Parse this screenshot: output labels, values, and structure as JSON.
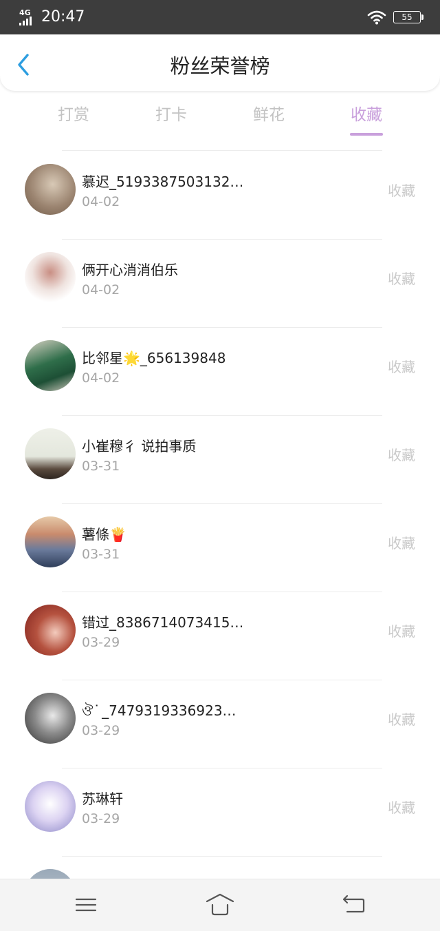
{
  "status_bar": {
    "network": "4G",
    "time": "20:47",
    "battery": "55"
  },
  "header": {
    "title": "粉丝荣誉榜"
  },
  "tabs": [
    {
      "label": "打赏",
      "active": false
    },
    {
      "label": "打卡",
      "active": false
    },
    {
      "label": "鲜花",
      "active": false
    },
    {
      "label": "收藏",
      "active": true
    }
  ],
  "accent_color": "#c9a0dc",
  "fans": [
    {
      "name": "慕迟_5193387503132…",
      "date": "04-02",
      "action": "收藏"
    },
    {
      "name": "俩开心消消伯乐",
      "date": "04-02",
      "action": "收藏"
    },
    {
      "name": "比邻星🌟_656139848",
      "date": "04-02",
      "action": "收藏"
    },
    {
      "name": "小崔穆彳 说拍事质",
      "date": "03-31",
      "action": "收藏"
    },
    {
      "name": "薯條🍟",
      "date": "03-31",
      "action": "收藏"
    },
    {
      "name": "错过_8386714073415…",
      "date": "03-29",
      "action": "收藏"
    },
    {
      "name": "ঔ ͘ _7479319336923…",
      "date": "03-29",
      "action": "收藏"
    },
    {
      "name": "苏琳轩",
      "date": "03-29",
      "action": "收藏"
    }
  ]
}
